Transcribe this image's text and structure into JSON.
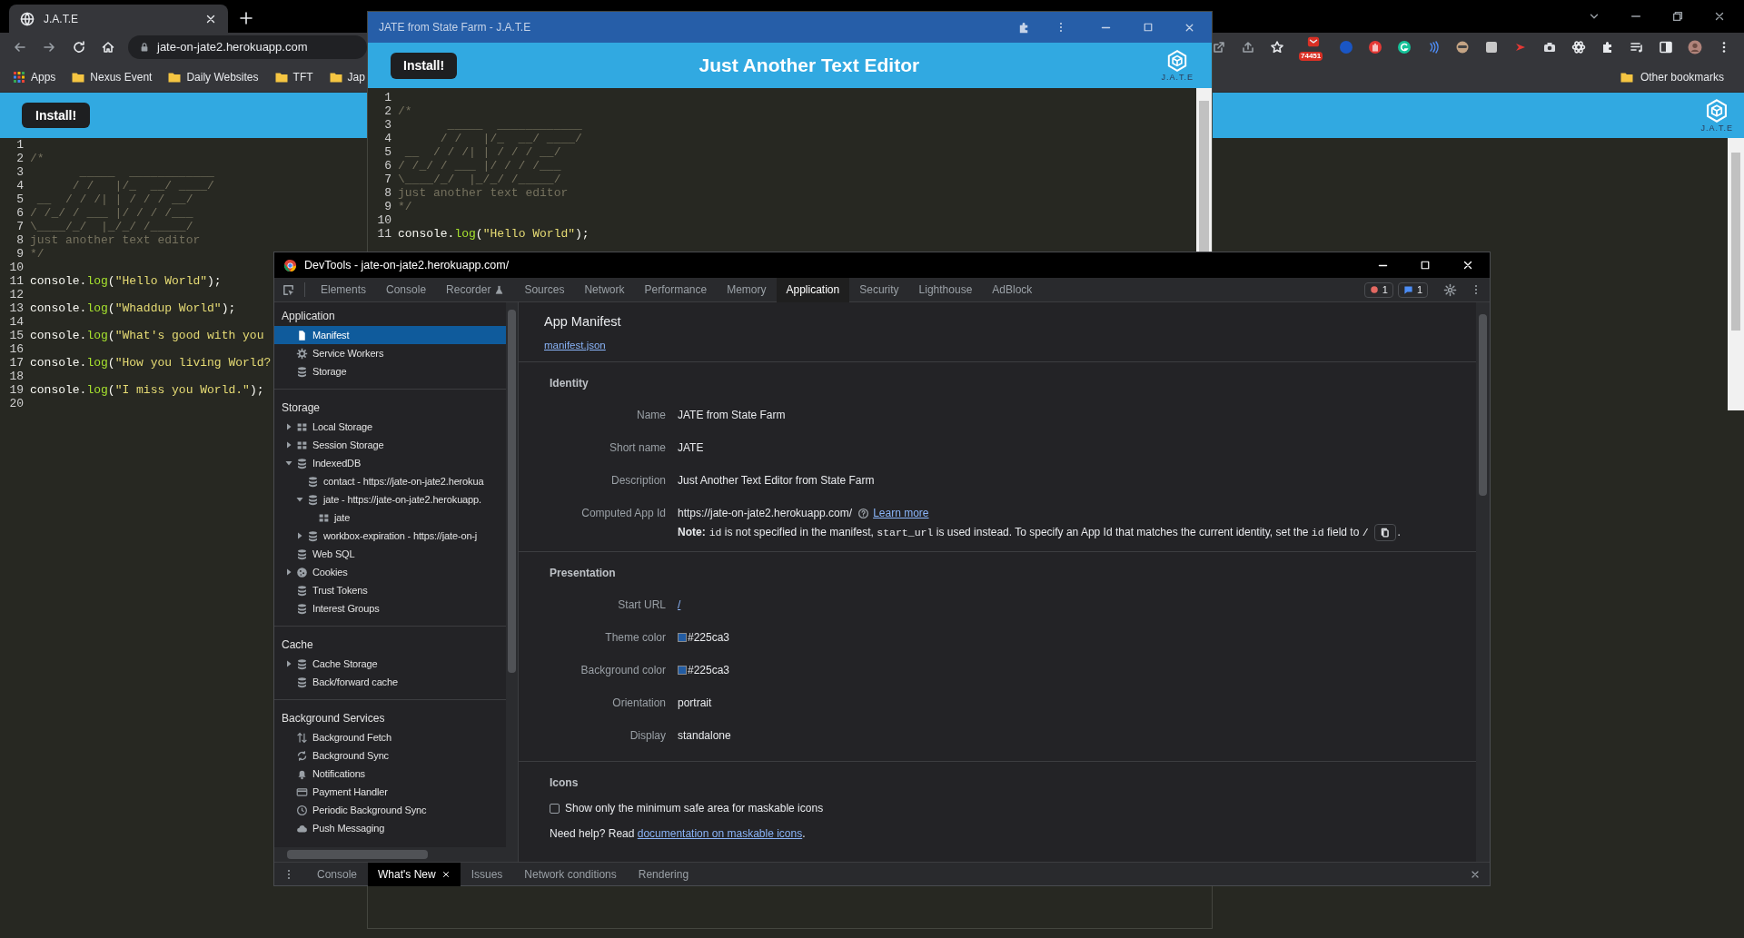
{
  "browser": {
    "tabs": [
      {
        "title": "J.A.T.E",
        "selected": true
      }
    ],
    "address": "jate-on-jate2.herokuapp.com",
    "extension_badge": "74451",
    "bookmarks": [
      {
        "label": "Apps",
        "kind": "apps"
      },
      {
        "label": "Nexus Event",
        "kind": "folder"
      },
      {
        "label": "Daily Websites",
        "kind": "folder"
      },
      {
        "label": "TFT",
        "kind": "folder"
      },
      {
        "label": "Jap",
        "kind": "folder"
      }
    ],
    "other_bookmarks": "Other bookmarks"
  },
  "page": {
    "install_button": "Install!",
    "logo_text": "J.A.T.E",
    "editor_lines": [
      {
        "number": "1"
      },
      {
        "number": "2",
        "tokens": [
          {
            "kind": "comment",
            "text": "/*"
          }
        ]
      },
      {
        "number": "3",
        "tokens": [
          {
            "kind": "comment",
            "text": "       _____  ____________"
          }
        ]
      },
      {
        "number": "4",
        "tokens": [
          {
            "kind": "comment",
            "text": "      / /   |/_  __/ ____/"
          }
        ]
      },
      {
        "number": "5",
        "tokens": [
          {
            "kind": "comment",
            "text": " __  / / /| | / / / __/"
          }
        ]
      },
      {
        "number": "6",
        "tokens": [
          {
            "kind": "comment",
            "text": "/ /_/ / ___ |/ / / /___"
          }
        ]
      },
      {
        "number": "7",
        "tokens": [
          {
            "kind": "comment",
            "text": "\\____/_/  |_/_/ /_____/"
          }
        ]
      },
      {
        "number": "8",
        "tokens": [
          {
            "kind": "comment",
            "text": "just another text editor"
          }
        ]
      },
      {
        "number": "9",
        "tokens": [
          {
            "kind": "comment",
            "text": "*/"
          }
        ]
      },
      {
        "number": "10"
      },
      {
        "number": "11",
        "tokens": [
          {
            "kind": "plain",
            "text": "console."
          },
          {
            "kind": "function",
            "text": "log"
          },
          {
            "kind": "plain",
            "text": "("
          },
          {
            "kind": "string",
            "text": "\"Hello World\""
          },
          {
            "kind": "plain",
            "text": ");"
          }
        ]
      },
      {
        "number": "12"
      },
      {
        "number": "13",
        "tokens": [
          {
            "kind": "plain",
            "text": "console."
          },
          {
            "kind": "function",
            "text": "log"
          },
          {
            "kind": "plain",
            "text": "("
          },
          {
            "kind": "string",
            "text": "\"Whaddup World\""
          },
          {
            "kind": "plain",
            "text": ");"
          }
        ]
      },
      {
        "number": "14"
      },
      {
        "number": "15",
        "tokens": [
          {
            "kind": "plain",
            "text": "console."
          },
          {
            "kind": "function",
            "text": "log"
          },
          {
            "kind": "plain",
            "text": "("
          },
          {
            "kind": "string",
            "text": "\"What's good with you"
          }
        ]
      },
      {
        "number": "16"
      },
      {
        "number": "17",
        "tokens": [
          {
            "kind": "plain",
            "text": "console."
          },
          {
            "kind": "function",
            "text": "log"
          },
          {
            "kind": "plain",
            "text": "("
          },
          {
            "kind": "string",
            "text": "\"How you living World?"
          }
        ]
      },
      {
        "number": "18"
      },
      {
        "number": "19",
        "tokens": [
          {
            "kind": "plain",
            "text": "console."
          },
          {
            "kind": "function",
            "text": "log"
          },
          {
            "kind": "plain",
            "text": "("
          },
          {
            "kind": "string",
            "text": "\"I miss you World.\""
          },
          {
            "kind": "plain",
            "text": ");"
          }
        ]
      },
      {
        "number": "20"
      }
    ]
  },
  "app_window": {
    "title": "JATE from State Farm - J.A.T.E",
    "install_button": "Install!",
    "heading": "Just Another Text Editor",
    "logo_text": "J.A.T.E",
    "editor_lines": [
      {
        "number": "1"
      },
      {
        "number": "2",
        "tokens": [
          {
            "kind": "comment",
            "text": "/*"
          }
        ]
      },
      {
        "number": "3",
        "tokens": [
          {
            "kind": "comment",
            "text": "       _____  ____________"
          }
        ]
      },
      {
        "number": "4",
        "tokens": [
          {
            "kind": "comment",
            "text": "      / /   |/_  __/ ____/"
          }
        ]
      },
      {
        "number": "5",
        "tokens": [
          {
            "kind": "comment",
            "text": " __  / / /| | / / / __/"
          }
        ]
      },
      {
        "number": "6",
        "tokens": [
          {
            "kind": "comment",
            "text": "/ /_/ / ___ |/ / / /___"
          }
        ]
      },
      {
        "number": "7",
        "tokens": [
          {
            "kind": "comment",
            "text": "\\____/_/  |_/_/ /_____/"
          }
        ]
      },
      {
        "number": "8",
        "tokens": [
          {
            "kind": "comment",
            "text": "just another text editor"
          }
        ]
      },
      {
        "number": "9",
        "tokens": [
          {
            "kind": "comment",
            "text": "*/"
          }
        ]
      },
      {
        "number": "10"
      },
      {
        "number": "11",
        "tokens": [
          {
            "kind": "plain",
            "text": "console."
          },
          {
            "kind": "function",
            "text": "log"
          },
          {
            "kind": "plain",
            "text": "("
          },
          {
            "kind": "string",
            "text": "\"Hello World\""
          },
          {
            "kind": "plain",
            "text": ");"
          }
        ]
      }
    ]
  },
  "devtools": {
    "title": "DevTools - jate-on-jate2.herokuapp.com/",
    "tabs": [
      {
        "label": "Elements",
        "selected": false,
        "kind": "plain"
      },
      {
        "label": "Console",
        "selected": false,
        "kind": "plain"
      },
      {
        "label": "Recorder",
        "selected": false,
        "kind": "experimental"
      },
      {
        "label": "Sources",
        "selected": false,
        "kind": "plain"
      },
      {
        "label": "Network",
        "selected": false,
        "kind": "plain"
      },
      {
        "label": "Performance",
        "selected": false,
        "kind": "plain"
      },
      {
        "label": "Memory",
        "selected": false,
        "kind": "plain"
      },
      {
        "label": "Application",
        "selected": true,
        "kind": "plain"
      },
      {
        "label": "Security",
        "selected": false,
        "kind": "plain"
      },
      {
        "label": "Lighthouse",
        "selected": false,
        "kind": "plain"
      },
      {
        "label": "AdBlock",
        "selected": false,
        "kind": "plain"
      }
    ],
    "error_count": "1",
    "message_count": "1",
    "sidebar": [
      {
        "heading": "Application",
        "items": [
          {
            "label": "Manifest",
            "kind": "file",
            "selected": true
          },
          {
            "label": "Service Workers",
            "kind": "gear",
            "selected": false
          },
          {
            "label": "Storage",
            "kind": "db",
            "selected": false
          }
        ]
      },
      {
        "heading": "Storage",
        "items": [
          {
            "label": "Local Storage",
            "kind": "table",
            "selected": false,
            "expanded": false
          },
          {
            "label": "Session Storage",
            "kind": "table",
            "selected": false,
            "expanded": false
          },
          {
            "label": "IndexedDB",
            "kind": "db",
            "selected": false,
            "expanded": true,
            "children": [
              {
                "label": "contact - https://jate-on-jate2.herokua",
                "kind": "db",
                "selected": false
              },
              {
                "label": "jate - https://jate-on-jate2.herokuapp.",
                "kind": "db",
                "selected": false,
                "expanded": true,
                "children": [
                  {
                    "label": "jate",
                    "kind": "table",
                    "selected": false
                  }
                ]
              },
              {
                "label": "workbox-expiration - https://jate-on-j",
                "kind": "db",
                "selected": false,
                "expanded": false
              }
            ]
          },
          {
            "label": "Web SQL",
            "kind": "db",
            "selected": false
          },
          {
            "label": "Cookies",
            "kind": "cookie",
            "selected": false,
            "expanded": false
          },
          {
            "label": "Trust Tokens",
            "kind": "db",
            "selected": false
          },
          {
            "label": "Interest Groups",
            "kind": "db",
            "selected": false
          }
        ]
      },
      {
        "heading": "Cache",
        "items": [
          {
            "label": "Cache Storage",
            "kind": "db",
            "selected": false,
            "expanded": false
          },
          {
            "label": "Back/forward cache",
            "kind": "db",
            "selected": false
          }
        ]
      },
      {
        "heading": "Background Services",
        "items": [
          {
            "label": "Background Fetch",
            "kind": "arrows",
            "selected": false
          },
          {
            "label": "Background Sync",
            "kind": "sync",
            "selected": false
          },
          {
            "label": "Notifications",
            "kind": "bell",
            "selected": false
          },
          {
            "label": "Payment Handler",
            "kind": "card",
            "selected": false
          },
          {
            "label": "Periodic Background Sync",
            "kind": "clock",
            "selected": false
          },
          {
            "label": "Push Messaging",
            "kind": "cloud",
            "selected": false
          }
        ]
      }
    ],
    "manifest": {
      "title": "App Manifest",
      "link": "manifest.json",
      "identity": {
        "heading": "Identity",
        "rows": [
          {
            "label": "Name",
            "value": "JATE from State Farm"
          },
          {
            "label": "Short name",
            "value": "JATE"
          },
          {
            "label": "Description",
            "value": "Just Another Text Editor from State Farm"
          }
        ],
        "app_id": {
          "label": "Computed App Id",
          "value": "https://jate-on-jate2.herokuapp.com/",
          "link": "Learn more"
        },
        "note": [
          {
            "kind": "bold",
            "text": "Note:"
          },
          {
            "kind": "code",
            "text": "id"
          },
          {
            "kind": "text",
            "text": " is not specified in the manifest, "
          },
          {
            "kind": "code",
            "text": "start_url"
          },
          {
            "kind": "text",
            "text": " is used instead. To specify an App Id that matches the current identity, set the "
          },
          {
            "kind": "code",
            "text": "id"
          },
          {
            "kind": "text",
            "text": " field to "
          },
          {
            "kind": "code",
            "text": "/"
          }
        ],
        "note_end": "."
      },
      "presentation": {
        "heading": "Presentation",
        "rows": [
          {
            "kind": "link",
            "label": "Start URL",
            "value": "/"
          },
          {
            "kind": "color",
            "label": "Theme color",
            "value": "#225ca3",
            "color": "#225ca3"
          },
          {
            "kind": "color",
            "label": "Background color",
            "value": "#225ca3",
            "color": "#225ca3"
          },
          {
            "kind": "text",
            "label": "Orientation",
            "value": "portrait"
          },
          {
            "kind": "text",
            "label": "Display",
            "value": "standalone"
          }
        ]
      },
      "icons": {
        "heading": "Icons",
        "checkbox": {
          "label": "Show only the minimum safe area for maskable icons",
          "checked": false
        },
        "help": "Need help? Read ",
        "help_link": "documentation on maskable icons",
        "help_end": "."
      }
    },
    "drawer_tabs": [
      {
        "label": "Console",
        "selected": false,
        "closable": false
      },
      {
        "label": "What's New",
        "selected": true,
        "closable": true
      },
      {
        "label": "Issues",
        "selected": false,
        "closable": false
      },
      {
        "label": "Network conditions",
        "selected": false,
        "closable": false
      },
      {
        "label": "Rendering",
        "selected": false,
        "closable": false
      }
    ]
  }
}
